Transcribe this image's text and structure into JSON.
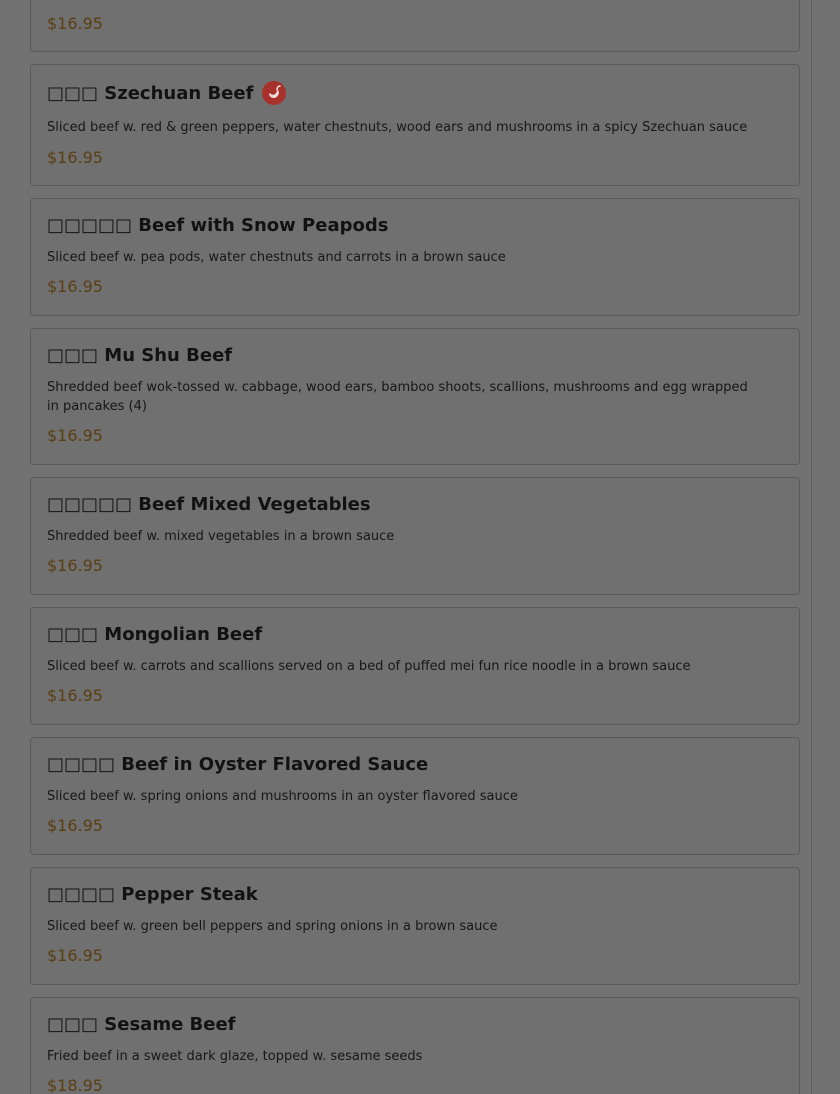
{
  "menu": {
    "items": [
      {
        "name": "",
        "description": "",
        "price": "$16.95",
        "spicy": false
      },
      {
        "name": "□□□ Szechuan Beef",
        "description": "Sliced beef w. red & green peppers, water chestnuts, wood ears and mushrooms in a spicy Szechuan sauce",
        "price": "$16.95",
        "spicy": true
      },
      {
        "name": "□□□□□ Beef with Snow Peapods",
        "description": "Sliced beef w. pea pods, water chestnuts and carrots in a brown sauce",
        "price": "$16.95",
        "spicy": false
      },
      {
        "name": "□□□ Mu Shu Beef",
        "description": "Shredded beef wok-tossed w. cabbage, wood ears, bamboo shoots, scallions, mushrooms and egg wrapped in pancakes (4)",
        "price": "$16.95",
        "spicy": false
      },
      {
        "name": "□□□□□ Beef Mixed Vegetables",
        "description": "Shredded beef w. mixed vegetables in a brown sauce",
        "price": "$16.95",
        "spicy": false
      },
      {
        "name": "□□□ Mongolian Beef",
        "description": "Sliced beef w. carrots and scallions served on a bed of puffed mei fun rice noodle in a brown sauce",
        "price": "$16.95",
        "spicy": false
      },
      {
        "name": "□□□□ Beef in Oyster Flavored Sauce",
        "description": "Sliced beef w. spring onions and mushrooms in an oyster flavored sauce",
        "price": "$16.95",
        "spicy": false
      },
      {
        "name": "□□□□ Pepper Steak",
        "description": "Sliced beef w. green bell peppers and spring onions in a brown sauce",
        "price": "$16.95",
        "spicy": false
      },
      {
        "name": "□□□ Sesame Beef",
        "description": "Fried beef in a sweet dark glaze, topped w. sesame seeds",
        "price": "$18.95",
        "spicy": false
      }
    ],
    "spicy_icon": "chili-pepper-icon",
    "colors": {
      "spicy_badge": "#c0392b",
      "price": "#5a3e12"
    }
  }
}
